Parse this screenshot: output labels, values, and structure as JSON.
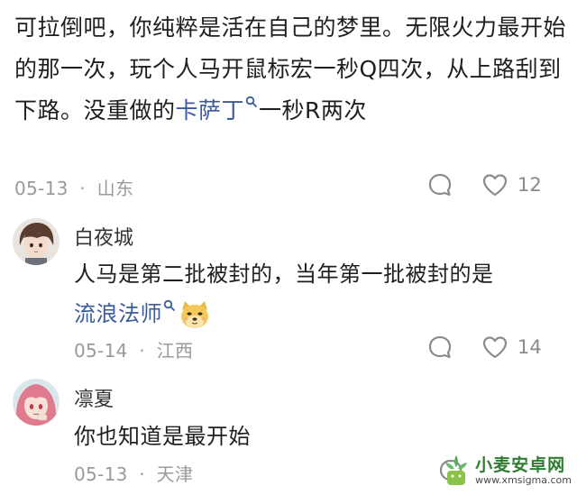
{
  "main_comment": {
    "text_before_link": "可拉倒吧，你纯粹是活在自己的梦里。无限火力最开始的那一次，玩个人马开鼠标宏一秒Q四次，从上路刮到下路。没重做的",
    "link": "卡萨丁",
    "text_after_link": "一秒R两次",
    "date": "05-13",
    "separator": "·",
    "location": "山东",
    "like_count": "12"
  },
  "replies": [
    {
      "username": "白夜城",
      "text_line1": "人马是第二批被封的，当年第一批被封的是",
      "link": "流浪法师",
      "date": "05-14",
      "separator": "·",
      "location": "江西",
      "like_count": "14"
    },
    {
      "username": "凛夏",
      "text": "你也知道是最开始",
      "date": "05-13",
      "separator": "·",
      "location": "天津"
    }
  ],
  "watermark": {
    "brand": "小麦安卓网",
    "url": "www.xmsigma.com"
  },
  "icons": {
    "reply": "comment-bubble-icon",
    "like": "heart-icon",
    "search": "search-magnifier-icon",
    "emoji": "doge-emoji-icon"
  },
  "colors": {
    "link": "#3b5b9d",
    "meta": "#9a9a9a",
    "watermark_green": "#2e7d32"
  }
}
